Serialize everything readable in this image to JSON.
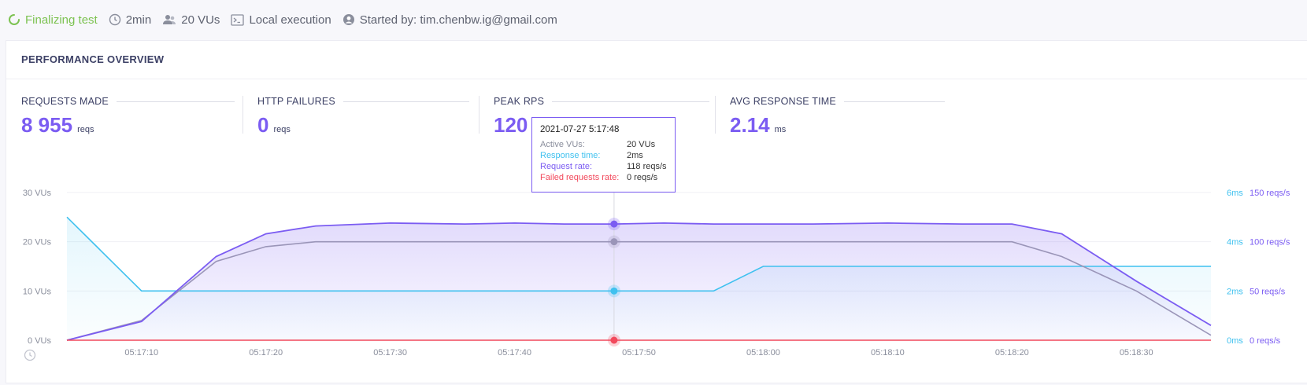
{
  "header": {
    "status": "Finalizing test",
    "duration": "2min",
    "vus": "20 VUs",
    "execution": "Local execution",
    "started_by": "Started by: tim.chenbw.ig@gmail.com"
  },
  "panel": {
    "title": "PERFORMANCE OVERVIEW"
  },
  "metrics": [
    {
      "label": "REQUESTS MADE",
      "value": "8 955",
      "unit": "reqs"
    },
    {
      "label": "HTTP FAILURES",
      "value": "0",
      "unit": "reqs"
    },
    {
      "label": "PEAK RPS",
      "value": "120",
      "unit": ""
    },
    {
      "label": "AVG RESPONSE TIME",
      "value": "2.14",
      "unit": "ms"
    }
  ],
  "tooltip": {
    "time": "2021-07-27 5:17:48",
    "rows": [
      {
        "label": "Active VUs:",
        "value": "20 VUs",
        "color": "#8a8e9c"
      },
      {
        "label": "Response time:",
        "value": "2ms",
        "color": "#3fc1ef"
      },
      {
        "label": "Request rate:",
        "value": "118 reqs/s",
        "color": "#7b5cf2"
      },
      {
        "label": "Failed requests rate:",
        "value": "0 reqs/s",
        "color": "#f2495c"
      }
    ]
  },
  "colors": {
    "vus": "#9a95b8",
    "response_time": "#3fc1ef",
    "request_rate": "#7b5cf2",
    "failed": "#f2495c",
    "status": "#7cc251"
  },
  "chart_data": {
    "type": "line",
    "x": [
      "05:17:04",
      "05:17:10",
      "05:17:16",
      "05:17:20",
      "05:17:24",
      "05:17:30",
      "05:17:36",
      "05:17:40",
      "05:17:44",
      "05:17:48",
      "05:17:52",
      "05:17:56",
      "05:18:00",
      "05:18:04",
      "05:18:10",
      "05:18:16",
      "05:18:20",
      "05:18:24",
      "05:18:30",
      "05:18:36"
    ],
    "xticks": [
      "05:17:10",
      "05:17:20",
      "05:17:30",
      "05:17:40",
      "05:17:50",
      "05:18:00",
      "05:18:10",
      "05:18:20",
      "05:18:30"
    ],
    "series": [
      {
        "name": "Active VUs",
        "axis": "vus",
        "values": [
          0,
          4,
          16,
          19,
          20,
          20,
          20,
          20,
          20,
          20,
          20,
          20,
          20,
          20,
          20,
          20,
          20,
          17,
          10,
          1
        ]
      },
      {
        "name": "Response time",
        "axis": "ms",
        "values": [
          5,
          2,
          2,
          2,
          2,
          2,
          2,
          2,
          2,
          2,
          2,
          2,
          3,
          3,
          3,
          3,
          3,
          3,
          3,
          3
        ]
      },
      {
        "name": "Request rate",
        "axis": "reqs",
        "values": [
          0,
          19,
          85,
          108,
          116,
          119,
          118,
          119,
          118,
          118,
          119,
          118,
          118,
          118,
          119,
          118,
          118,
          108,
          60,
          15
        ]
      },
      {
        "name": "Failed requests rate",
        "axis": "reqs",
        "values": [
          0,
          0,
          0,
          0,
          0,
          0,
          0,
          0,
          0,
          0,
          0,
          0,
          0,
          0,
          0,
          0,
          0,
          0,
          0,
          0
        ]
      }
    ],
    "left_axis": {
      "ticks": [
        "0 VUs",
        "10 VUs",
        "20 VUs",
        "30 VUs"
      ],
      "ylim": [
        0,
        30
      ]
    },
    "right_axis_ms": {
      "ticks": [
        "0ms",
        "2ms",
        "4ms",
        "6ms"
      ],
      "ylim": [
        0,
        6
      ]
    },
    "right_axis_reqs": {
      "ticks": [
        "0 reqs/s",
        "50 reqs/s",
        "100 reqs/s",
        "150 reqs/s"
      ],
      "ylim": [
        0,
        150
      ]
    },
    "hover_x": "05:17:48"
  }
}
